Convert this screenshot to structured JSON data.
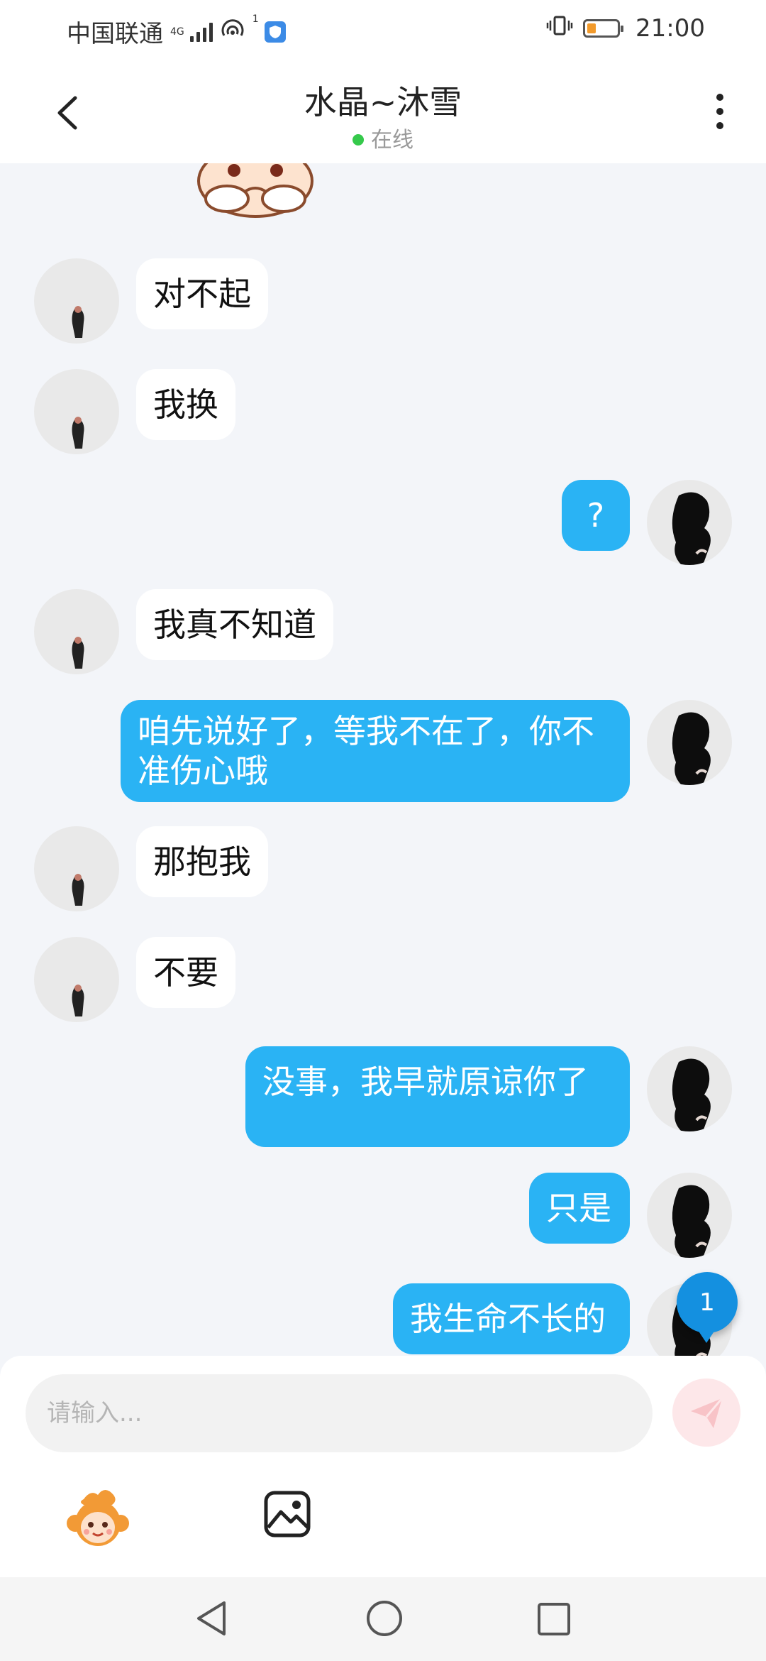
{
  "status_bar": {
    "carrier": "中国联通",
    "network": "4G",
    "hotspot_count": "1",
    "time": "21:00"
  },
  "header": {
    "title": "水晶~沐雪",
    "status": "在线"
  },
  "messages": [
    {
      "side": "in",
      "text": "对不起"
    },
    {
      "side": "in",
      "text": "我换"
    },
    {
      "side": "out",
      "text": "?"
    },
    {
      "side": "in",
      "text": "我真不知道"
    },
    {
      "side": "out",
      "text": "咱先说好了，等我不在了，你不准伤心哦"
    },
    {
      "side": "in",
      "text": "那抱我"
    },
    {
      "side": "in",
      "text": "不要"
    },
    {
      "side": "out",
      "text": "没事，我早就原谅你了"
    },
    {
      "side": "out",
      "text": "只是"
    },
    {
      "side": "out",
      "text": "我生命不长的"
    }
  ],
  "unread_badge": "1",
  "input": {
    "placeholder": "请输入..."
  },
  "colors": {
    "out_bubble": "#2ab3f4",
    "in_bubble": "#ffffff",
    "online_dot": "#35c94b",
    "badge": "#1490e0"
  }
}
